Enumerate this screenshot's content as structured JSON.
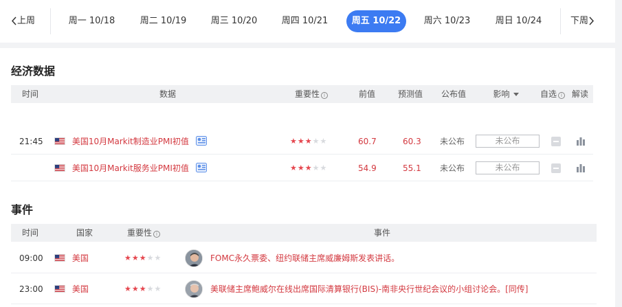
{
  "nav": {
    "prev_label": "上周",
    "next_label": "下周",
    "days": [
      {
        "label": "周一 10/18",
        "active": false
      },
      {
        "label": "周二 10/19",
        "active": false
      },
      {
        "label": "周三 10/20",
        "active": false
      },
      {
        "label": "周四 10/21",
        "active": false
      },
      {
        "label": "周五 10/22",
        "active": true
      },
      {
        "label": "周六 10/23",
        "active": false
      },
      {
        "label": "周日 10/24",
        "active": false
      }
    ]
  },
  "econ": {
    "title": "经济数据",
    "headers": {
      "time": "时间",
      "data": "数据",
      "importance": "重要性",
      "previous": "前值",
      "forecast": "预测值",
      "actual": "公布值",
      "impact": "影响",
      "watch": "自选",
      "interpret": "解读"
    },
    "rows": [
      {
        "time": "21:45",
        "country_flag": "us-flag",
        "name": "美国10月Markit制造业PMI初值",
        "importance": 3,
        "previous": "60.7",
        "forecast": "60.3",
        "actual": "未公布",
        "impact": "未公布"
      },
      {
        "time": "",
        "country_flag": "us-flag",
        "name": "美国10月Markit服务业PMI初值",
        "importance": 3,
        "previous": "54.9",
        "forecast": "55.1",
        "actual": "未公布",
        "impact": "未公布"
      }
    ]
  },
  "events": {
    "title": "事件",
    "headers": {
      "time": "时间",
      "country": "国家",
      "importance": "重要性",
      "event": "事件"
    },
    "rows": [
      {
        "time": "09:00",
        "country": "美国",
        "importance": 3,
        "text": "FOMC永久票委、纽约联储主席威廉姆斯发表讲话。"
      },
      {
        "time": "23:00",
        "country": "美国",
        "importance": 3,
        "text": "美联储主席鲍威尔在线出席国际清算银行(BIS)-南非央行世纪会议的小组讨论会。[同传]"
      }
    ]
  },
  "colors": {
    "accent": "#3c7bf2",
    "red_text": "#d3383f",
    "star_on": "#e5474f",
    "star_off": "#d8dade"
  }
}
